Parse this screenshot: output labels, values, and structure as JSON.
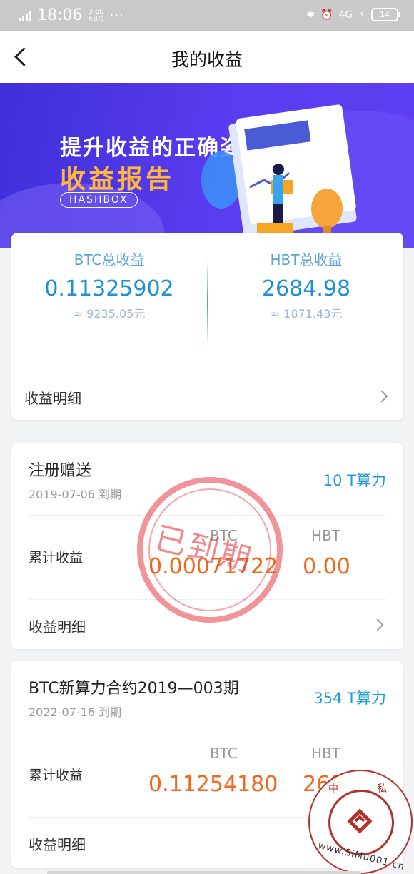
{
  "status": {
    "time": "18:06",
    "network": "4G HD",
    "speed_value": "3.60",
    "speed_unit": "KB/s",
    "dots": "···",
    "signal2": "4G",
    "battery": "14"
  },
  "header": {
    "title": "我的收益"
  },
  "banner": {
    "slogan": "提升收益的正确姿势",
    "subtitle": "收益报告",
    "tag": "HASHBOX"
  },
  "summary": {
    "btc_label": "BTC总收益",
    "btc_value": "0.11325902",
    "btc_approx": "≈ 9235.05元",
    "hbt_label": "HBT总收益",
    "hbt_value": "2684.98",
    "hbt_approx": "≈ 1871.43元",
    "detail_label": "收益明细"
  },
  "contracts": [
    {
      "name": "注册赠送",
      "date": "2019-07-06 到期",
      "power": "10 T算力",
      "cum_label": "累计收益",
      "btc_header": "BTC",
      "hbt_header": "HBT",
      "btc_value": "0.00071722",
      "hbt_value": "0.00",
      "detail_label": "收益明细",
      "stamp": "已到期"
    },
    {
      "name": "BTC新算力合约2019—003期",
      "date": "2022-07-16 到期",
      "power": "354 T算力",
      "cum_label": "累计收益",
      "btc_header": "BTC",
      "hbt_header": "HBT",
      "btc_value": "0.11254180",
      "hbt_value": "268",
      "detail_label": "收益明细"
    }
  ],
  "watermark": {
    "left": "中",
    "right": "私",
    "site": "www.SiMu001.cn"
  },
  "colors": {
    "accent": "#1f8fd6",
    "earning": "#ef6a1e",
    "banner": "#4a33e6",
    "stamp": "#e63c46"
  }
}
